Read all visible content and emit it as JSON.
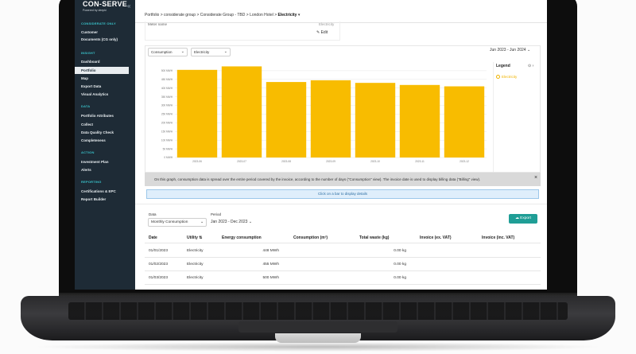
{
  "app": {
    "logo_text": "CON-SERVE",
    "logo_sub": "Powered by deepki",
    "collapse_glyph": "«"
  },
  "sidebar": {
    "sections": [
      {
        "title": "CONSIDERATE ONLY",
        "items": [
          {
            "label": "Customer"
          },
          {
            "label": "Documents (CG only)"
          }
        ]
      },
      {
        "title": "INSIGHT",
        "items": [
          {
            "label": "Dashboard"
          },
          {
            "label": "Portfolio",
            "active": true
          },
          {
            "label": "Map"
          },
          {
            "label": "Export Data"
          },
          {
            "label": "Visual Analytics"
          }
        ]
      },
      {
        "title": "DATA",
        "items": [
          {
            "label": "Portfolio Attributes"
          },
          {
            "label": "Collect"
          },
          {
            "label": "Data Quality Check"
          },
          {
            "label": "Completeness"
          }
        ]
      },
      {
        "title": "ACTION",
        "items": [
          {
            "label": "Investment Plan"
          },
          {
            "label": "Alerts"
          }
        ]
      },
      {
        "title": "REPORTING",
        "items": [
          {
            "label": "Certifications & EPC"
          },
          {
            "label": "Report Builder"
          }
        ]
      }
    ]
  },
  "breadcrumb": {
    "items": [
      "Portfolio",
      "considerate group",
      "Considerate Group - TBD",
      "London Hotel"
    ],
    "current": "Electricity",
    "separator": ">"
  },
  "meter": {
    "label": "Meter name",
    "value": "Electricity",
    "edit_label": "Edit"
  },
  "chart_controls": {
    "view_select": "Consumption",
    "utility_select": "Electricity",
    "period": "Jun 2023 - Jun 2024"
  },
  "legend": {
    "title": "Legend",
    "items": [
      {
        "label": "Electricity",
        "color": "#f0b400"
      }
    ]
  },
  "chart_data": {
    "type": "bar",
    "categories": [
      "2023-06",
      "2023-07",
      "2023-08",
      "2023-09",
      "2023-10",
      "2023-11",
      "2023-12"
    ],
    "series": [
      {
        "name": "Electricity",
        "values": [
          505,
          525,
          435,
          445,
          430,
          418,
          410
        ],
        "color": "#f8bc00"
      }
    ],
    "ylim": [
      0,
      550
    ],
    "yticks": [
      0,
      50,
      100,
      150,
      200,
      250,
      300,
      350,
      400,
      450,
      500
    ],
    "ytick_labels": [
      "0 MWH",
      "50 MWH",
      "100 MWH",
      "150 MWH",
      "200 MWH",
      "250 MWH",
      "300 MWH",
      "350 MWH",
      "400 MWH",
      "450 MWH",
      "500 MWH"
    ],
    "grid": true
  },
  "info": {
    "message": "On this graph, consumption data is spread over the entire period covered by the invoice, according to the number of days (\"Consumption\" view). The invoice date is used to display billing data (\"Billing\" view).",
    "close_glyph": "×",
    "click_hint": "Click on a bar to display details"
  },
  "table_controls": {
    "data_label": "Data",
    "data_value": "Monthly Consumption",
    "period_label": "Period",
    "period_value": "Jan 2023 - Dec 2023",
    "export_label": "Export"
  },
  "table": {
    "headers": [
      "Date",
      "Utility",
      "Energy consumption",
      "Consumption (m³)",
      "Total waste (kg)",
      "Invoice (ex. VAT)",
      "Invoice (inc. VAT)"
    ],
    "rows": [
      {
        "date": "01/01/2023",
        "utility": "Electricity",
        "energy": "448 MWh",
        "m3": "",
        "waste": "0.00 kg",
        "ex_vat": "",
        "inc_vat": ""
      },
      {
        "date": "01/02/2023",
        "utility": "Electricity",
        "energy": "455 MWh",
        "m3": "",
        "waste": "0.00 kg",
        "ex_vat": "",
        "inc_vat": ""
      },
      {
        "date": "01/03/2023",
        "utility": "Electricity",
        "energy": "500 MWh",
        "m3": "",
        "waste": "0.00 kg",
        "ex_vat": "",
        "inc_vat": ""
      }
    ]
  }
}
